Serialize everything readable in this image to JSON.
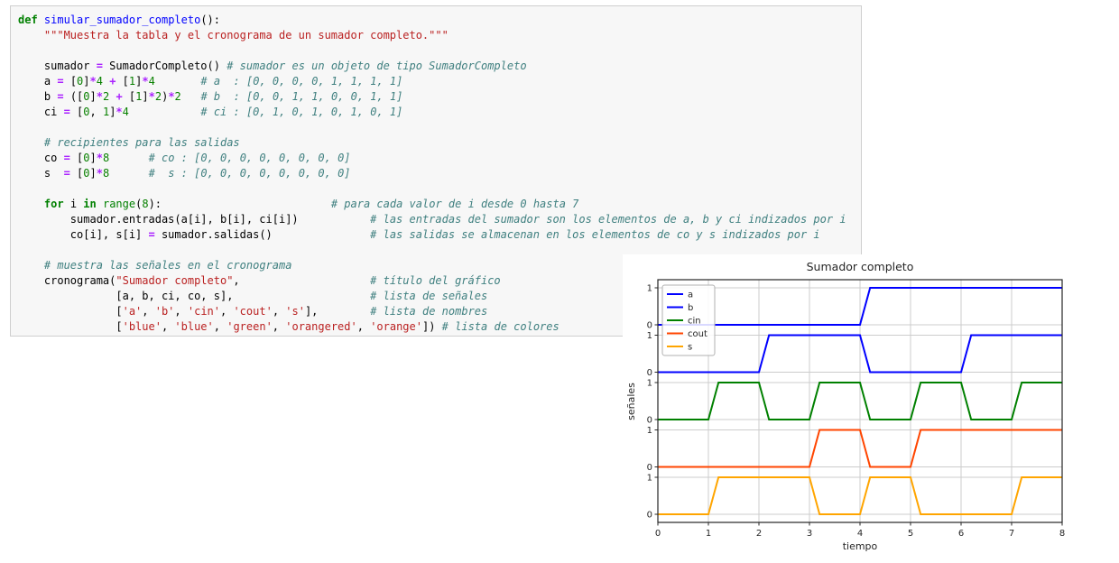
{
  "code_cell": {
    "language": "python",
    "lines": [
      [
        [
          "kw",
          "def"
        ],
        [
          "pln",
          " "
        ],
        [
          "fn",
          "simular_sumador_completo"
        ],
        [
          "pln",
          "():"
        ]
      ],
      [
        [
          "pln",
          "    "
        ],
        [
          "str",
          "\"\"\"Muestra la tabla y el cronograma de un sumador completo.\"\"\""
        ]
      ],
      [],
      [
        [
          "pln",
          "    sumador "
        ],
        [
          "op",
          "="
        ],
        [
          "pln",
          " SumadorCompleto() "
        ],
        [
          "com",
          "# sumador es un objeto de tipo SumadorCompleto"
        ]
      ],
      [
        [
          "pln",
          "    a "
        ],
        [
          "op",
          "="
        ],
        [
          "pln",
          " ["
        ],
        [
          "num",
          "0"
        ],
        [
          "pln",
          "]"
        ],
        [
          "op",
          "*"
        ],
        [
          "num",
          "4"
        ],
        [
          "pln",
          " "
        ],
        [
          "op",
          "+"
        ],
        [
          "pln",
          " ["
        ],
        [
          "num",
          "1"
        ],
        [
          "pln",
          "]"
        ],
        [
          "op",
          "*"
        ],
        [
          "num",
          "4"
        ],
        [
          "pln",
          "       "
        ],
        [
          "com",
          "# a  : [0, 0, 0, 0, 1, 1, 1, 1]"
        ]
      ],
      [
        [
          "pln",
          "    b "
        ],
        [
          "op",
          "="
        ],
        [
          "pln",
          " (["
        ],
        [
          "num",
          "0"
        ],
        [
          "pln",
          "]"
        ],
        [
          "op",
          "*"
        ],
        [
          "num",
          "2"
        ],
        [
          "pln",
          " "
        ],
        [
          "op",
          "+"
        ],
        [
          "pln",
          " ["
        ],
        [
          "num",
          "1"
        ],
        [
          "pln",
          "]"
        ],
        [
          "op",
          "*"
        ],
        [
          "num",
          "2"
        ],
        [
          "pln",
          ")"
        ],
        [
          "op",
          "*"
        ],
        [
          "num",
          "2"
        ],
        [
          "pln",
          "   "
        ],
        [
          "com",
          "# b  : [0, 0, 1, 1, 0, 0, 1, 1]"
        ]
      ],
      [
        [
          "pln",
          "    ci "
        ],
        [
          "op",
          "="
        ],
        [
          "pln",
          " ["
        ],
        [
          "num",
          "0"
        ],
        [
          "pln",
          ", "
        ],
        [
          "num",
          "1"
        ],
        [
          "pln",
          "]"
        ],
        [
          "op",
          "*"
        ],
        [
          "num",
          "4"
        ],
        [
          "pln",
          "           "
        ],
        [
          "com",
          "# ci : [0, 1, 0, 1, 0, 1, 0, 1]"
        ]
      ],
      [],
      [
        [
          "pln",
          "    "
        ],
        [
          "com",
          "# recipientes para las salidas"
        ]
      ],
      [
        [
          "pln",
          "    co "
        ],
        [
          "op",
          "="
        ],
        [
          "pln",
          " ["
        ],
        [
          "num",
          "0"
        ],
        [
          "pln",
          "]"
        ],
        [
          "op",
          "*"
        ],
        [
          "num",
          "8"
        ],
        [
          "pln",
          "      "
        ],
        [
          "com",
          "# co : [0, 0, 0, 0, 0, 0, 0, 0]"
        ]
      ],
      [
        [
          "pln",
          "    s  "
        ],
        [
          "op",
          "="
        ],
        [
          "pln",
          " ["
        ],
        [
          "num",
          "0"
        ],
        [
          "pln",
          "]"
        ],
        [
          "op",
          "*"
        ],
        [
          "num",
          "8"
        ],
        [
          "pln",
          "      "
        ],
        [
          "com",
          "#  s : [0, 0, 0, 0, 0, 0, 0, 0]"
        ]
      ],
      [],
      [
        [
          "pln",
          "    "
        ],
        [
          "kw",
          "for"
        ],
        [
          "pln",
          " i "
        ],
        [
          "kw",
          "in"
        ],
        [
          "pln",
          " "
        ],
        [
          "bi",
          "range"
        ],
        [
          "pln",
          "("
        ],
        [
          "num",
          "8"
        ],
        [
          "pln",
          "):"
        ],
        [
          "pln",
          "                          "
        ],
        [
          "com",
          "# para cada valor de i desde 0 hasta 7"
        ]
      ],
      [
        [
          "pln",
          "        sumador.entradas(a[i], b[i], ci[i])"
        ],
        [
          "pln",
          "           "
        ],
        [
          "com",
          "# las entradas del sumador son los elementos de a, b y ci indizados por i"
        ]
      ],
      [
        [
          "pln",
          "        co[i], s[i] "
        ],
        [
          "op",
          "="
        ],
        [
          "pln",
          " sumador.salidas()"
        ],
        [
          "pln",
          "               "
        ],
        [
          "com",
          "# las salidas se almacenan en los elementos de co y s indizados por i"
        ]
      ],
      [],
      [
        [
          "pln",
          "    "
        ],
        [
          "com",
          "# muestra las señales en el cronograma"
        ]
      ],
      [
        [
          "pln",
          "    cronograma("
        ],
        [
          "str",
          "\"Sumador completo\""
        ],
        [
          "pln",
          ","
        ],
        [
          "pln",
          "                    "
        ],
        [
          "com",
          "# título del gráfico"
        ]
      ],
      [
        [
          "pln",
          "               [a, b, ci, co, s],"
        ],
        [
          "pln",
          "                     "
        ],
        [
          "com",
          "# lista de señales"
        ]
      ],
      [
        [
          "pln",
          "               ["
        ],
        [
          "str",
          "'a'"
        ],
        [
          "pln",
          ", "
        ],
        [
          "str",
          "'b'"
        ],
        [
          "pln",
          ", "
        ],
        [
          "str",
          "'cin'"
        ],
        [
          "pln",
          ", "
        ],
        [
          "str",
          "'cout'"
        ],
        [
          "pln",
          ", "
        ],
        [
          "str",
          "'s'"
        ],
        [
          "pln",
          "],"
        ],
        [
          "pln",
          "        "
        ],
        [
          "com",
          "# lista de nombres"
        ]
      ],
      [
        [
          "pln",
          "               ["
        ],
        [
          "str",
          "'blue'"
        ],
        [
          "pln",
          ", "
        ],
        [
          "str",
          "'blue'"
        ],
        [
          "pln",
          ", "
        ],
        [
          "str",
          "'green'"
        ],
        [
          "pln",
          ", "
        ],
        [
          "str",
          "'orangered'"
        ],
        [
          "pln",
          ", "
        ],
        [
          "str",
          "'orange'"
        ],
        [
          "pln",
          "]) "
        ],
        [
          "com",
          "# lista de colores"
        ]
      ]
    ]
  },
  "chart_data": {
    "type": "line",
    "subtype": "digital-timing-diagram",
    "title": "Sumador completo",
    "xlabel": "tiempo",
    "ylabel": "señales",
    "xlim": [
      0,
      8
    ],
    "x_ticks": [
      "0",
      "1",
      "2",
      "3",
      "4",
      "5",
      "6",
      "7",
      "8"
    ],
    "band_tick_labels": [
      "0",
      "1"
    ],
    "transition_ramp": 0.2,
    "grid": true,
    "legend_position": "upper left",
    "grid_color": "#cccccc",
    "spine_color": "#262626",
    "legend_border_color": "#b0b0b0",
    "series": [
      {
        "name": "a",
        "color": "#0000ff",
        "values": [
          0,
          0,
          0,
          0,
          1,
          1,
          1,
          1
        ]
      },
      {
        "name": "b",
        "color": "#0000ff",
        "values": [
          0,
          0,
          1,
          1,
          0,
          0,
          1,
          1
        ]
      },
      {
        "name": "cin",
        "color": "#008000",
        "values": [
          0,
          1,
          0,
          1,
          0,
          1,
          0,
          1
        ]
      },
      {
        "name": "cout",
        "color": "#ff4500",
        "values": [
          0,
          0,
          0,
          1,
          0,
          1,
          1,
          1
        ]
      },
      {
        "name": "s",
        "color": "#ffa500",
        "values": [
          0,
          1,
          1,
          0,
          1,
          0,
          0,
          1
        ]
      }
    ]
  }
}
